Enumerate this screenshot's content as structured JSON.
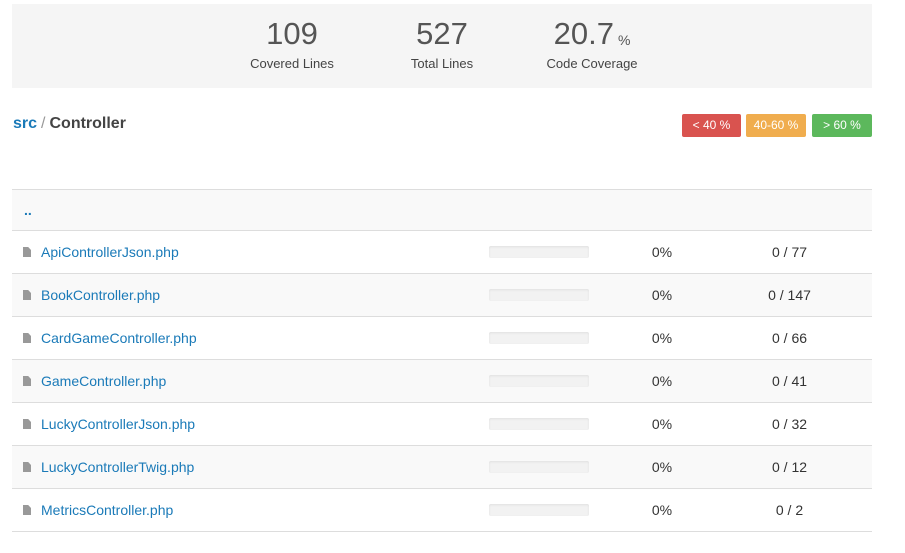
{
  "summary": {
    "covered": "109",
    "covered_label": "Covered Lines",
    "total": "527",
    "total_label": "Total Lines",
    "coverage": "20.7",
    "coverage_unit": "%",
    "coverage_label": "Code Coverage"
  },
  "breadcrumb": {
    "root": "src",
    "separator": "/",
    "current": "Controller"
  },
  "legend": {
    "low": "< 40 %",
    "mid": "40-60 %",
    "high": "> 60 %",
    "colors": {
      "low": "#d9534f",
      "mid": "#f0ad4e",
      "high": "#5cb85c"
    }
  },
  "table": {
    "parent_link": "..",
    "rows": [
      {
        "name": "ApiControllerJson.php",
        "coverage_fraction": 0,
        "percent": "0%",
        "lines": "0 / 77"
      },
      {
        "name": "BookController.php",
        "coverage_fraction": 0,
        "percent": "0%",
        "lines": "0 / 147"
      },
      {
        "name": "CardGameController.php",
        "coverage_fraction": 0,
        "percent": "0%",
        "lines": "0 / 66"
      },
      {
        "name": "GameController.php",
        "coverage_fraction": 0,
        "percent": "0%",
        "lines": "0 / 41"
      },
      {
        "name": "LuckyControllerJson.php",
        "coverage_fraction": 0,
        "percent": "0%",
        "lines": "0 / 32"
      },
      {
        "name": "LuckyControllerTwig.php",
        "coverage_fraction": 0,
        "percent": "0%",
        "lines": "0 / 12"
      },
      {
        "name": "MetricsController.php",
        "coverage_fraction": 0,
        "percent": "0%",
        "lines": "0 / 2"
      }
    ]
  }
}
